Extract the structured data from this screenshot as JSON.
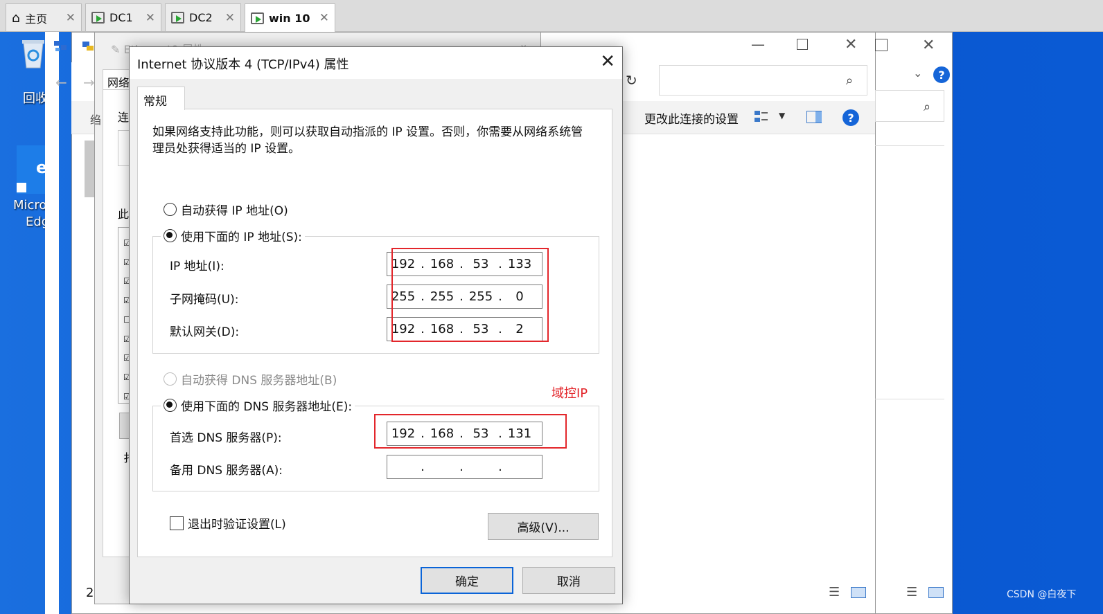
{
  "vm_tabs": [
    {
      "label": "主页",
      "icon": "home-icon"
    },
    {
      "label": "DC1",
      "icon": "vm-icon"
    },
    {
      "label": "DC2",
      "icon": "vm-icon"
    },
    {
      "label": "win 10",
      "icon": "vm-icon"
    }
  ],
  "desktop": {
    "recycle_label": "回收",
    "edge_label_line1": "Micro",
    "edge_label_line2": "Edg"
  },
  "bg_window": {
    "eth_title": "Ethernet0 属性",
    "net_tab": "网络",
    "conn_label": "连",
    "this_label": "此",
    "side_letter": "绉",
    "bottom_num": "2",
    "shortcut_letter": "扌",
    "change_settings": "更改此连接的设置"
  },
  "dialog": {
    "title": "Internet 协议版本 4 (TCP/IPv4) 属性",
    "close": "✕",
    "tab_general": "常规",
    "description": "如果网络支持此功能，则可以获取自动指派的 IP 设置。否则，你需要从网络系统管理员处获得适当的 IP 设置。",
    "auto_ip": "自动获得 IP 地址(O)",
    "use_ip": "使用下面的 IP 地址(S):",
    "ip_label": "IP 地址(I):",
    "mask_label": "子网掩码(U):",
    "gateway_label": "默认网关(D):",
    "ip": [
      "192",
      "168",
      "53",
      "133"
    ],
    "mask": [
      "255",
      "255",
      "255",
      "0"
    ],
    "gateway": [
      "192",
      "168",
      "53",
      "2"
    ],
    "auto_dns": "自动获得 DNS 服务器地址(B)",
    "use_dns": "使用下面的 DNS 服务器地址(E):",
    "preferred_dns_label": "首选 DNS 服务器(P):",
    "alternate_dns_label": "备用 DNS 服务器(A):",
    "preferred_dns": [
      "192",
      "168",
      "53",
      "131"
    ],
    "alternate_dns": [
      "",
      "",
      "",
      ""
    ],
    "annotation": "域控IP",
    "validate_label": "退出时验证设置(L)",
    "advanced_button": "高级(V)...",
    "ok_button": "确定",
    "cancel_button": "取消"
  },
  "watermark": "CSDN @白夜下",
  "colors": {
    "accent": "#0a64d8",
    "annotation_red": "#e3262b",
    "desktop_blue": "#0f5fd6"
  }
}
